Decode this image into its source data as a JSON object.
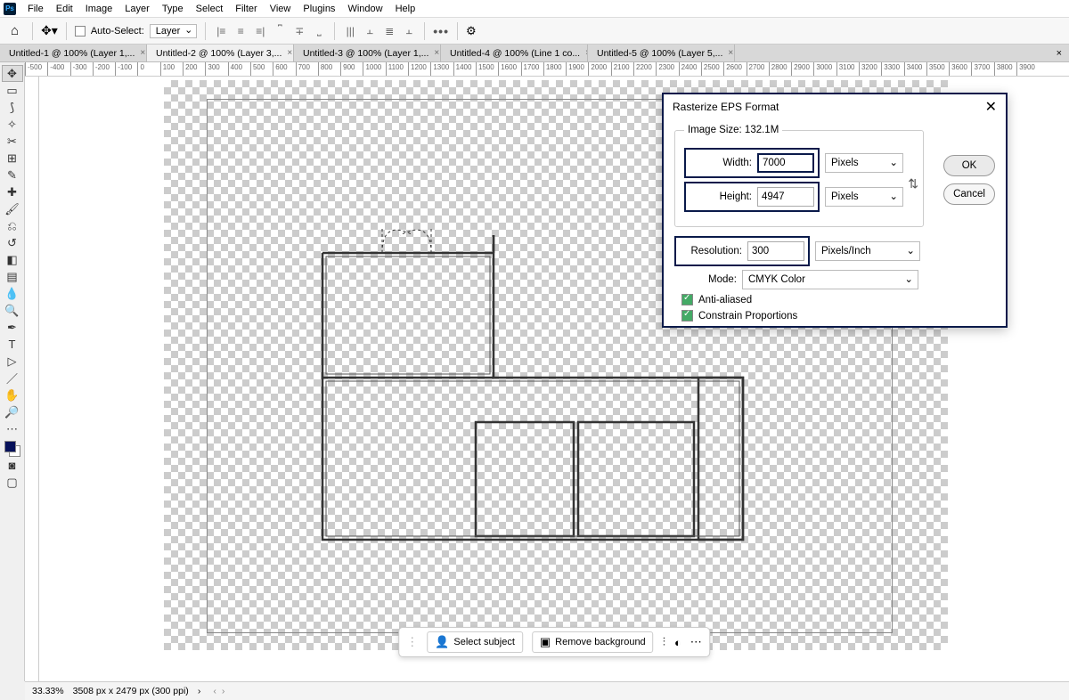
{
  "menu": [
    "File",
    "Edit",
    "Image",
    "Layer",
    "Type",
    "Select",
    "Filter",
    "View",
    "Plugins",
    "Window",
    "Help"
  ],
  "options": {
    "auto_select_label": "Auto-Select:",
    "auto_select_value": "Layer"
  },
  "tabs": [
    {
      "label": "Untitled-1 @ 100% (Layer 1,...",
      "active": false
    },
    {
      "label": "Untitled-2 @ 100% (Layer 3,...",
      "active": true
    },
    {
      "label": "Untitled-3 @ 100% (Layer 1,...",
      "active": false
    },
    {
      "label": "Untitled-4 @ 100% (Line 1 co...",
      "active": false
    },
    {
      "label": "Untitled-5 @ 100% (Layer 5,...",
      "active": false
    }
  ],
  "ruler_ticks": [
    "-500",
    "-400",
    "-300",
    "-200",
    "-100",
    "0",
    "100",
    "200",
    "300",
    "400",
    "500",
    "600",
    "700",
    "800",
    "900",
    "1000",
    "1100",
    "1200",
    "1300",
    "1400",
    "1500",
    "1600",
    "1700",
    "1800",
    "1900",
    "2000",
    "2100",
    "2200",
    "2300",
    "2400",
    "2500",
    "2600",
    "2700",
    "2800",
    "2900",
    "3000",
    "3100",
    "3200",
    "3300",
    "3400",
    "3500",
    "3600",
    "3700",
    "3800",
    "3900"
  ],
  "ctxbar": {
    "select_subject": "Select subject",
    "remove_bg": "Remove background"
  },
  "status": {
    "zoom": "33.33%",
    "dims": "3508 px x 2479 px (300 ppi)"
  },
  "dialog": {
    "title": "Rasterize EPS Format",
    "image_size_label": "Image Size: 132.1M",
    "width_label": "Width:",
    "width_value": "7000",
    "height_label": "Height:",
    "height_value": "4947",
    "pixels": "Pixels",
    "resolution_label": "Resolution:",
    "resolution_value": "300",
    "ppi": "Pixels/Inch",
    "mode_label": "Mode:",
    "mode_value": "CMYK Color",
    "antialiased": "Anti-aliased",
    "constrain": "Constrain Proportions",
    "ok": "OK",
    "cancel": "Cancel"
  }
}
